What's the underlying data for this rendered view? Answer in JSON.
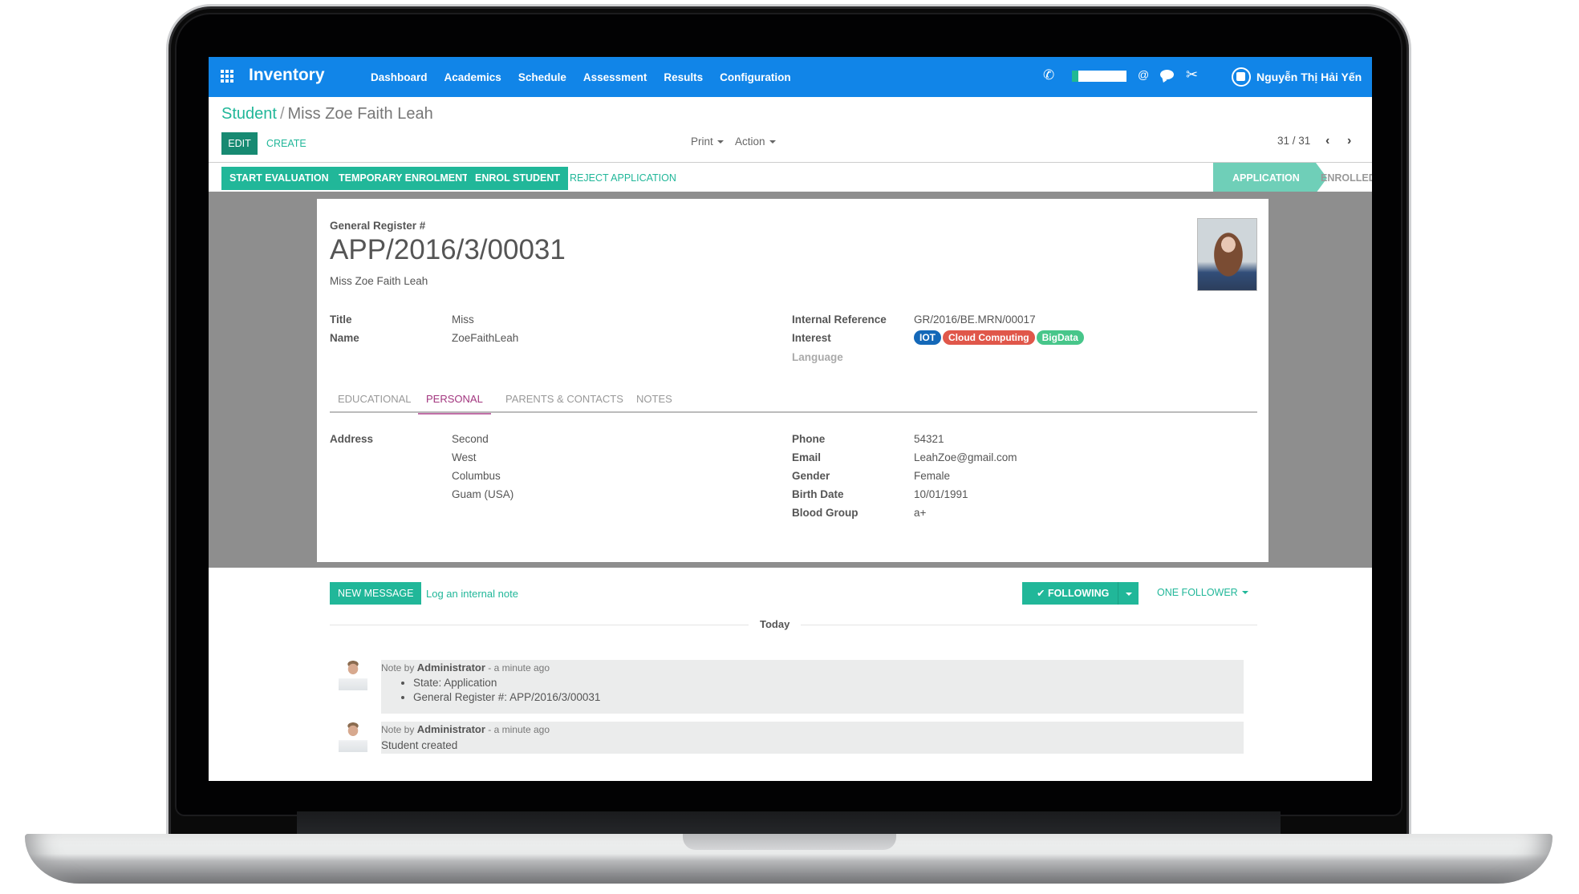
{
  "navbar": {
    "brand": "Inventory",
    "menu": [
      "Dashboard",
      "Academics",
      "Schedule",
      "Assessment",
      "Results",
      "Configuration"
    ],
    "icons": [
      "phone-icon",
      "at-icon",
      "chat-icon",
      "tools-icon"
    ],
    "progress_fraction": 0.12,
    "user_name": "Nguyễn Thị Hải Yến",
    "brand_color": "#1185e8"
  },
  "breadcrumb": {
    "parent": "Student",
    "separator": "/",
    "current": "Miss Zoe Faith Leah"
  },
  "control_panel": {
    "edit": "EDIT",
    "create": "CREATE",
    "print": "Print",
    "action": "Action",
    "pager": "31 / 31",
    "prev": "‹",
    "next": "›"
  },
  "statusbar": {
    "buttons": [
      "START EVALUATION",
      "TEMPORARY ENROLMENT",
      "ENROL STUDENT"
    ],
    "reject": "REJECT APPLICATION",
    "stages": [
      {
        "label": "APPLICATION",
        "active": true
      },
      {
        "label": "ENROLLED",
        "active": false
      }
    ],
    "accent_color": "#21b799"
  },
  "form": {
    "register_label": "General Register #",
    "register_value": "APP/2016/3/00031",
    "full_name": "Miss Zoe Faith Leah",
    "left_fields": [
      {
        "label": "Title",
        "value": "Miss"
      },
      {
        "label": "Name",
        "value": "ZoeFaithLeah"
      }
    ],
    "right_fields": {
      "internal_ref_label": "Internal Reference",
      "internal_ref_value": "GR/2016/BE.MRN/00017",
      "interest_label": "Interest",
      "interests": [
        {
          "label": "IOT",
          "color": "#1468b8"
        },
        {
          "label": "Cloud Computing",
          "color": "#e0574a"
        },
        {
          "label": "BigData",
          "color": "#47c68a"
        }
      ],
      "language_label": "Language"
    },
    "tabs": [
      {
        "label": "EDUCATIONAL",
        "active": false
      },
      {
        "label": "PERSONAL",
        "active": true
      },
      {
        "label": "PARENTS & CONTACTS",
        "active": false
      },
      {
        "label": "NOTES",
        "active": false
      }
    ],
    "personal": {
      "address_label": "Address",
      "address_lines": [
        "Second",
        "West",
        "Columbus",
        "Guam (USA)"
      ],
      "contact_fields": [
        {
          "label": "Phone",
          "value": "54321"
        },
        {
          "label": "Email",
          "value": "LeahZoe@gmail.com"
        },
        {
          "label": "Gender",
          "value": "Female"
        },
        {
          "label": "Birth Date",
          "value": "10/01/1991"
        },
        {
          "label": "Blood Group",
          "value": "a+"
        }
      ]
    }
  },
  "chatter": {
    "new_message": "NEW MESSAGE",
    "log_note": "Log an internal note",
    "following": "FOLLOWING",
    "followers": "ONE FOLLOWER",
    "day_separator": "Today",
    "messages": [
      {
        "prefix": "Note by",
        "author": "Administrator",
        "time": "- a minute ago",
        "items": [
          "State: Application",
          "General Register #: APP/2016/3/00031"
        ]
      },
      {
        "prefix": "Note by",
        "author": "Administrator",
        "time": "- a minute ago",
        "body": "Student created"
      }
    ]
  }
}
